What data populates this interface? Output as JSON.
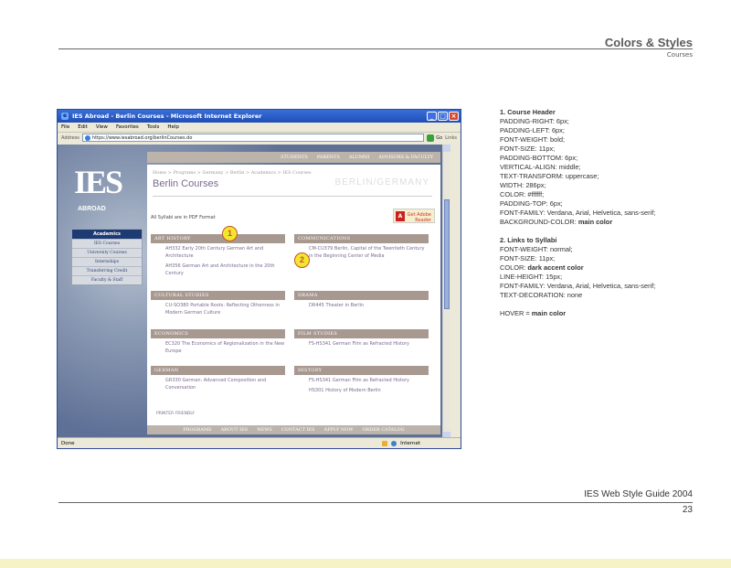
{
  "header": {
    "title": "Colors & Styles",
    "subtitle": "Courses"
  },
  "footer": {
    "guide": "IES Web Style Guide 2004",
    "page": "23"
  },
  "browser": {
    "title": "IES Abroad - Berlin Courses - Microsoft Internet Explorer",
    "menu": [
      "File",
      "Edit",
      "View",
      "Favorites",
      "Tools",
      "Help"
    ],
    "address_label": "Address",
    "address": "https://www.iesabroad.org/berlinCourses.do",
    "go": "Go",
    "links": "Links",
    "status_left": "Done",
    "status_right": "Internet"
  },
  "site": {
    "logo": "IES",
    "logo_sub": "ABROAD",
    "top_nav": [
      "STUDENTS",
      "PARENTS",
      "ALUMNI",
      "ADVISORS & FACULTY"
    ],
    "crumbs": "Home > Programs > Germany > Berlin > Academics > IES Courses",
    "page_title": "Berlin Courses",
    "watermark": "BERLIN/GERMANY",
    "side_nav": {
      "header": "Academics",
      "items": [
        "IES Courses",
        "University Courses",
        "Internships",
        "Transferring Credit",
        "Faculty & Staff"
      ]
    },
    "pdf_note": "All Syllabi are in PDF Format",
    "reader": {
      "get": "Get",
      "label": "Adobe Reader",
      "icon": "adobe-pdf-icon"
    },
    "categories": [
      {
        "title": "ART HISTORY",
        "links": [
          "AH332 Early 20th Century German Art and Architecture",
          "AH356 German Art and Architecture in the 20th Century"
        ]
      },
      {
        "title": "COMMUNICATIONS",
        "links": [
          "CM-CU379 Berlin, Capital of the Twentieth Century in the Beginning Center of Media"
        ]
      },
      {
        "title": "CULTURAL STUDIES",
        "links": [
          "CU-SO380 Portable Roots: Reflecting Otherness in Modern German Culture"
        ]
      },
      {
        "title": "DRAMA",
        "links": [
          "DR445 Theater in Berlin"
        ]
      },
      {
        "title": "ECONOMICS",
        "links": [
          "EC320 The Economics of Regionalization in the New Europe"
        ]
      },
      {
        "title": "FILM STUDIES",
        "links": [
          "FS-HS341 German Film as Refracted History"
        ]
      },
      {
        "title": "GERMAN",
        "links": [
          "GR330 German: Advanced Composition and Conversation"
        ]
      },
      {
        "title": "HISTORY",
        "links": [
          "FS-HS341 German Film as Refracted History",
          "HS301 History of Modern Berlin"
        ]
      }
    ],
    "markers": [
      "1",
      "2"
    ],
    "printer": "PRINTER FRIENDLY",
    "footer_nav": [
      "PROGRAMS",
      "ABOUT IES",
      "NEWS",
      "CONTACT IES",
      "APPLY NOW",
      "ORDER CATALOG"
    ]
  },
  "spec": {
    "s1_title": "1. Course Header",
    "s1": [
      "PADDING-RIGHT: 6px;",
      "PADDING-LEFT: 6px;",
      "FONT-WEIGHT: bold;",
      "FONT-SIZE: 11px;",
      "PADDING-BOTTOM: 6px;",
      "VERTICAL-ALIGN: middle;",
      "TEXT-TRANSFORM: uppercase;",
      "WIDTH: 286px;",
      "COLOR: #ffffff;",
      "PADDING-TOP: 6px;",
      "FONT-FAMILY: Verdana, Arial, Helvetica, sans-serif;"
    ],
    "s1_bg_prefix": "BACKGROUND-COLOR: ",
    "s1_bg_value": "main color",
    "s2_title": "2. Links to Syllabi",
    "s2a": [
      "FONT-WEIGHT: normal;",
      "FONT-SIZE: 11px;"
    ],
    "s2_color_prefix": "COLOR: ",
    "s2_color_value": "dark accent color",
    "s2b": [
      "LINE-HEIGHT: 15px;",
      "FONT-FAMILY: Verdana, Arial, Helvetica, sans-serif;",
      "TEXT-DECORATION: none"
    ],
    "hover_prefix": "HOVER = ",
    "hover_value": "main color"
  }
}
